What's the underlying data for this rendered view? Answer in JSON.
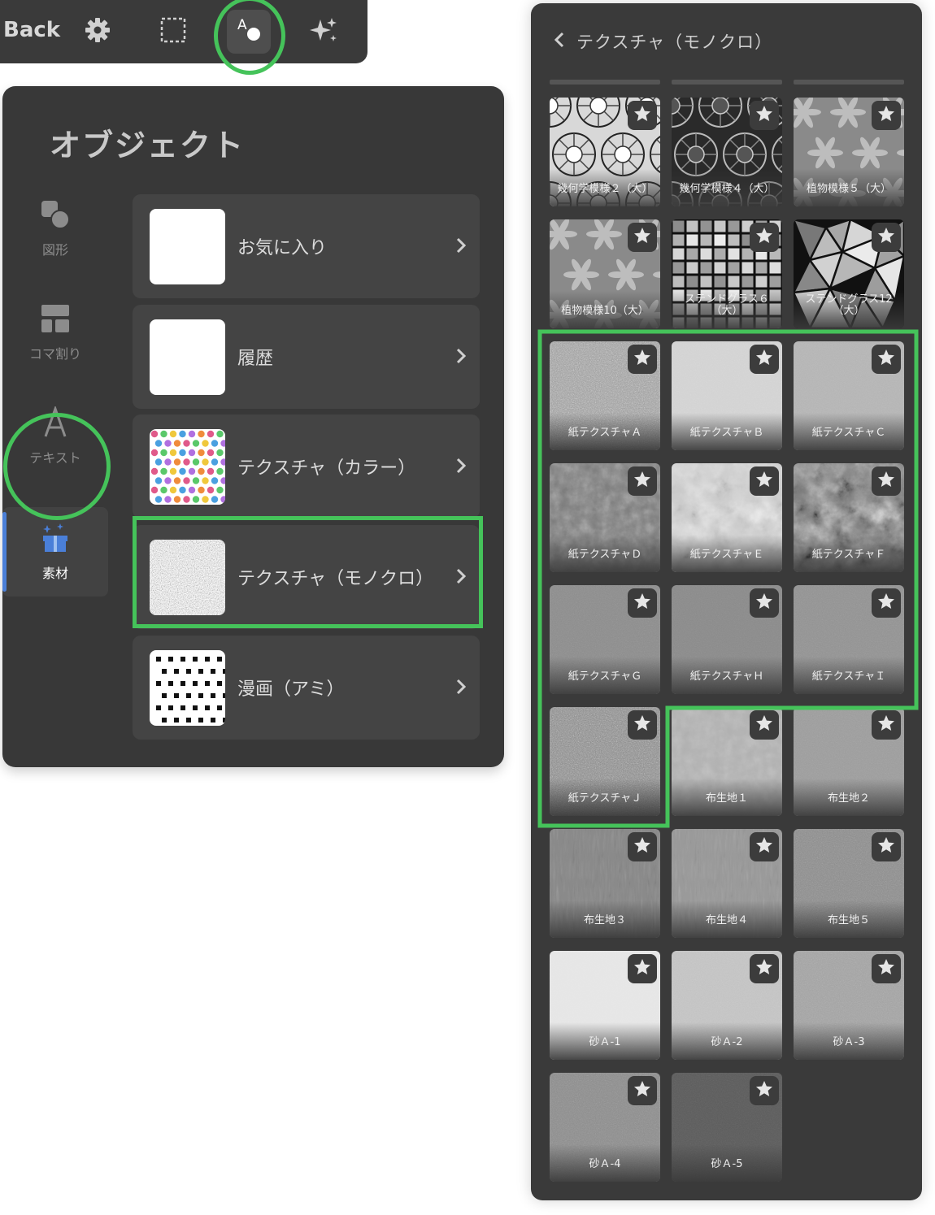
{
  "toolbar": {
    "back_label": "Back",
    "icons": [
      "gear-icon",
      "selection-icon",
      "object-icon",
      "sparkle-icon"
    ],
    "active": "object-icon"
  },
  "object_panel": {
    "title": "オブジェクト",
    "categories": [
      {
        "label": "図形",
        "icon": "shapes-icon"
      },
      {
        "label": "コマ割り",
        "icon": "panel-layout-icon"
      },
      {
        "label": "テキスト",
        "icon": "text-icon"
      },
      {
        "label": "素材",
        "icon": "material-box-icon",
        "active": true
      }
    ],
    "rows": [
      {
        "label": "お気に入り",
        "thumb": "blank"
      },
      {
        "label": "履歴",
        "thumb": "blank"
      },
      {
        "label": "テクスチャ（カラー）",
        "thumb": "color-dots"
      },
      {
        "label": "テクスチャ（モノクロ）",
        "thumb": "mono-noise",
        "highlighted": true
      },
      {
        "label": "漫画（アミ）",
        "thumb": "halftone-dots"
      }
    ]
  },
  "texture_panel": {
    "title": "テクスチャ（モノクロ）",
    "tiles": [
      {
        "label": "幾何学模様２（大）",
        "style": "geo2"
      },
      {
        "label": "幾何学模様４（大）",
        "style": "geo4"
      },
      {
        "label": "植物模様５（大）",
        "style": "plant"
      },
      {
        "label": "植物模様10（大）",
        "style": "plant"
      },
      {
        "label": "ステンドグラス６\n（大）",
        "style": "stained6"
      },
      {
        "label": "ステンドグラス12\n（大）",
        "style": "stained12"
      },
      {
        "label": "紙テクスチャＡ",
        "style": "paperA"
      },
      {
        "label": "紙テクスチャＢ",
        "style": "paperB"
      },
      {
        "label": "紙テクスチャＣ",
        "style": "paperC"
      },
      {
        "label": "紙テクスチャＤ",
        "style": "paperD"
      },
      {
        "label": "紙テクスチャＥ",
        "style": "paperE"
      },
      {
        "label": "紙テクスチャＦ",
        "style": "paperF"
      },
      {
        "label": "紙テクスチャＧ",
        "style": "paperG"
      },
      {
        "label": "紙テクスチャＨ",
        "style": "paperH"
      },
      {
        "label": "紙テクスチャＩ",
        "style": "paperI"
      },
      {
        "label": "紙テクスチャＪ",
        "style": "paperJ"
      },
      {
        "label": "布生地１",
        "style": "cloth1"
      },
      {
        "label": "布生地２",
        "style": "cloth2"
      },
      {
        "label": "布生地３",
        "style": "cloth3"
      },
      {
        "label": "布生地４",
        "style": "cloth4"
      },
      {
        "label": "布生地５",
        "style": "cloth5"
      },
      {
        "label": "砂Ａ-1",
        "style": "sand1"
      },
      {
        "label": "砂Ａ-2",
        "style": "sand2"
      },
      {
        "label": "砂Ａ-3",
        "style": "sand3"
      },
      {
        "label": "砂Ａ-4",
        "style": "sand4"
      },
      {
        "label": "砂Ａ-5",
        "style": "sand5"
      }
    ]
  },
  "colors": {
    "highlight": "#45c35a",
    "accent": "#4a7fd8",
    "panel_bg": "#383838"
  }
}
